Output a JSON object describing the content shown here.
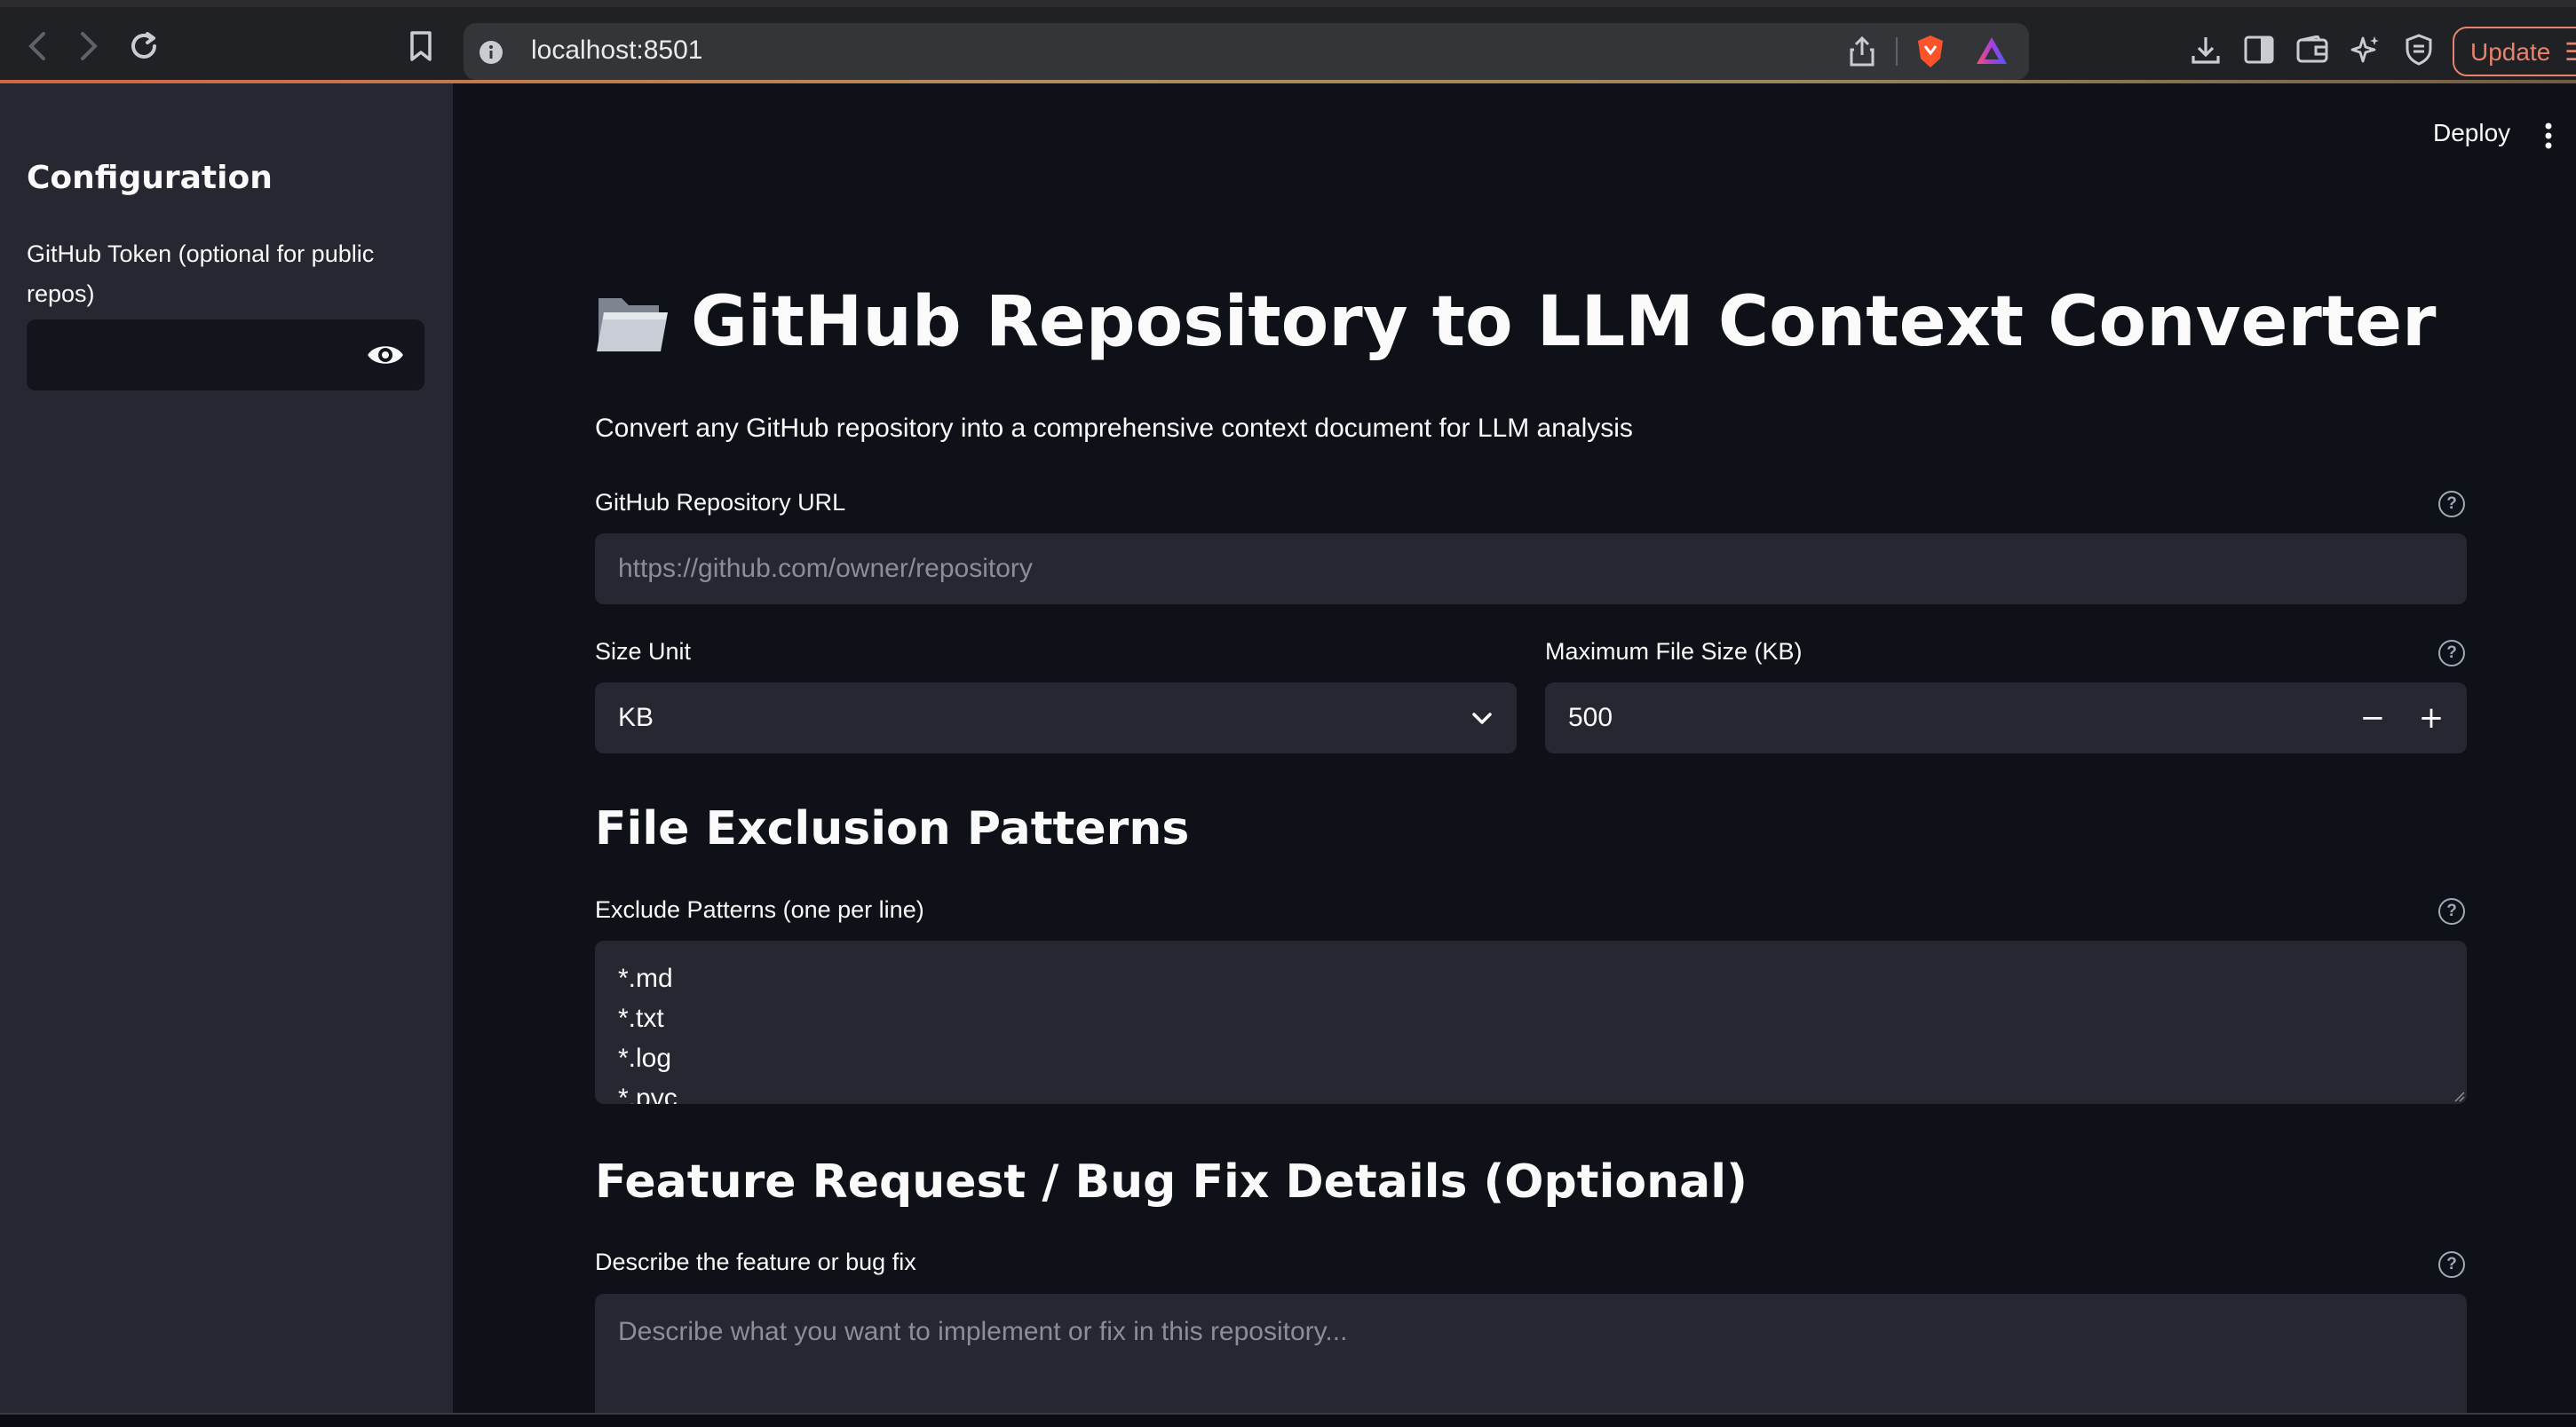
{
  "browser": {
    "url": "localhost:8501",
    "update_label": "Update"
  },
  "sidebar": {
    "title": "Configuration",
    "token_label_line1": "GitHub Token (optional for public",
    "token_label_line2": "repos)",
    "token_value": ""
  },
  "header": {
    "deploy_label": "Deploy"
  },
  "main": {
    "title": "GitHub Repository to LLM Context Converter",
    "subtitle": "Convert any GitHub repository into a comprehensive context document for LLM analysis",
    "repo_url": {
      "label": "GitHub Repository URL",
      "placeholder": "https://github.com/owner/repository",
      "value": ""
    },
    "size_unit": {
      "label": "Size Unit",
      "selected": "KB"
    },
    "max_size": {
      "label": "Maximum File Size (KB)",
      "value": "500",
      "decrement": "−",
      "increment": "+"
    },
    "exclusion": {
      "heading": "File Exclusion Patterns",
      "label": "Exclude Patterns (one per line)",
      "lines": [
        "*.md",
        "*.txt",
        "*.log",
        "*.pyc"
      ]
    },
    "feature": {
      "heading": "Feature Request / Bug Fix Details (Optional)",
      "label": "Describe the feature or bug fix",
      "placeholder": "Describe what you want to implement or fix in this repository..."
    }
  },
  "colors": {
    "sidebar_bg": "#262730",
    "main_bg": "#0e1117",
    "input_bg": "#262730",
    "accent_update": "#e7836c"
  }
}
